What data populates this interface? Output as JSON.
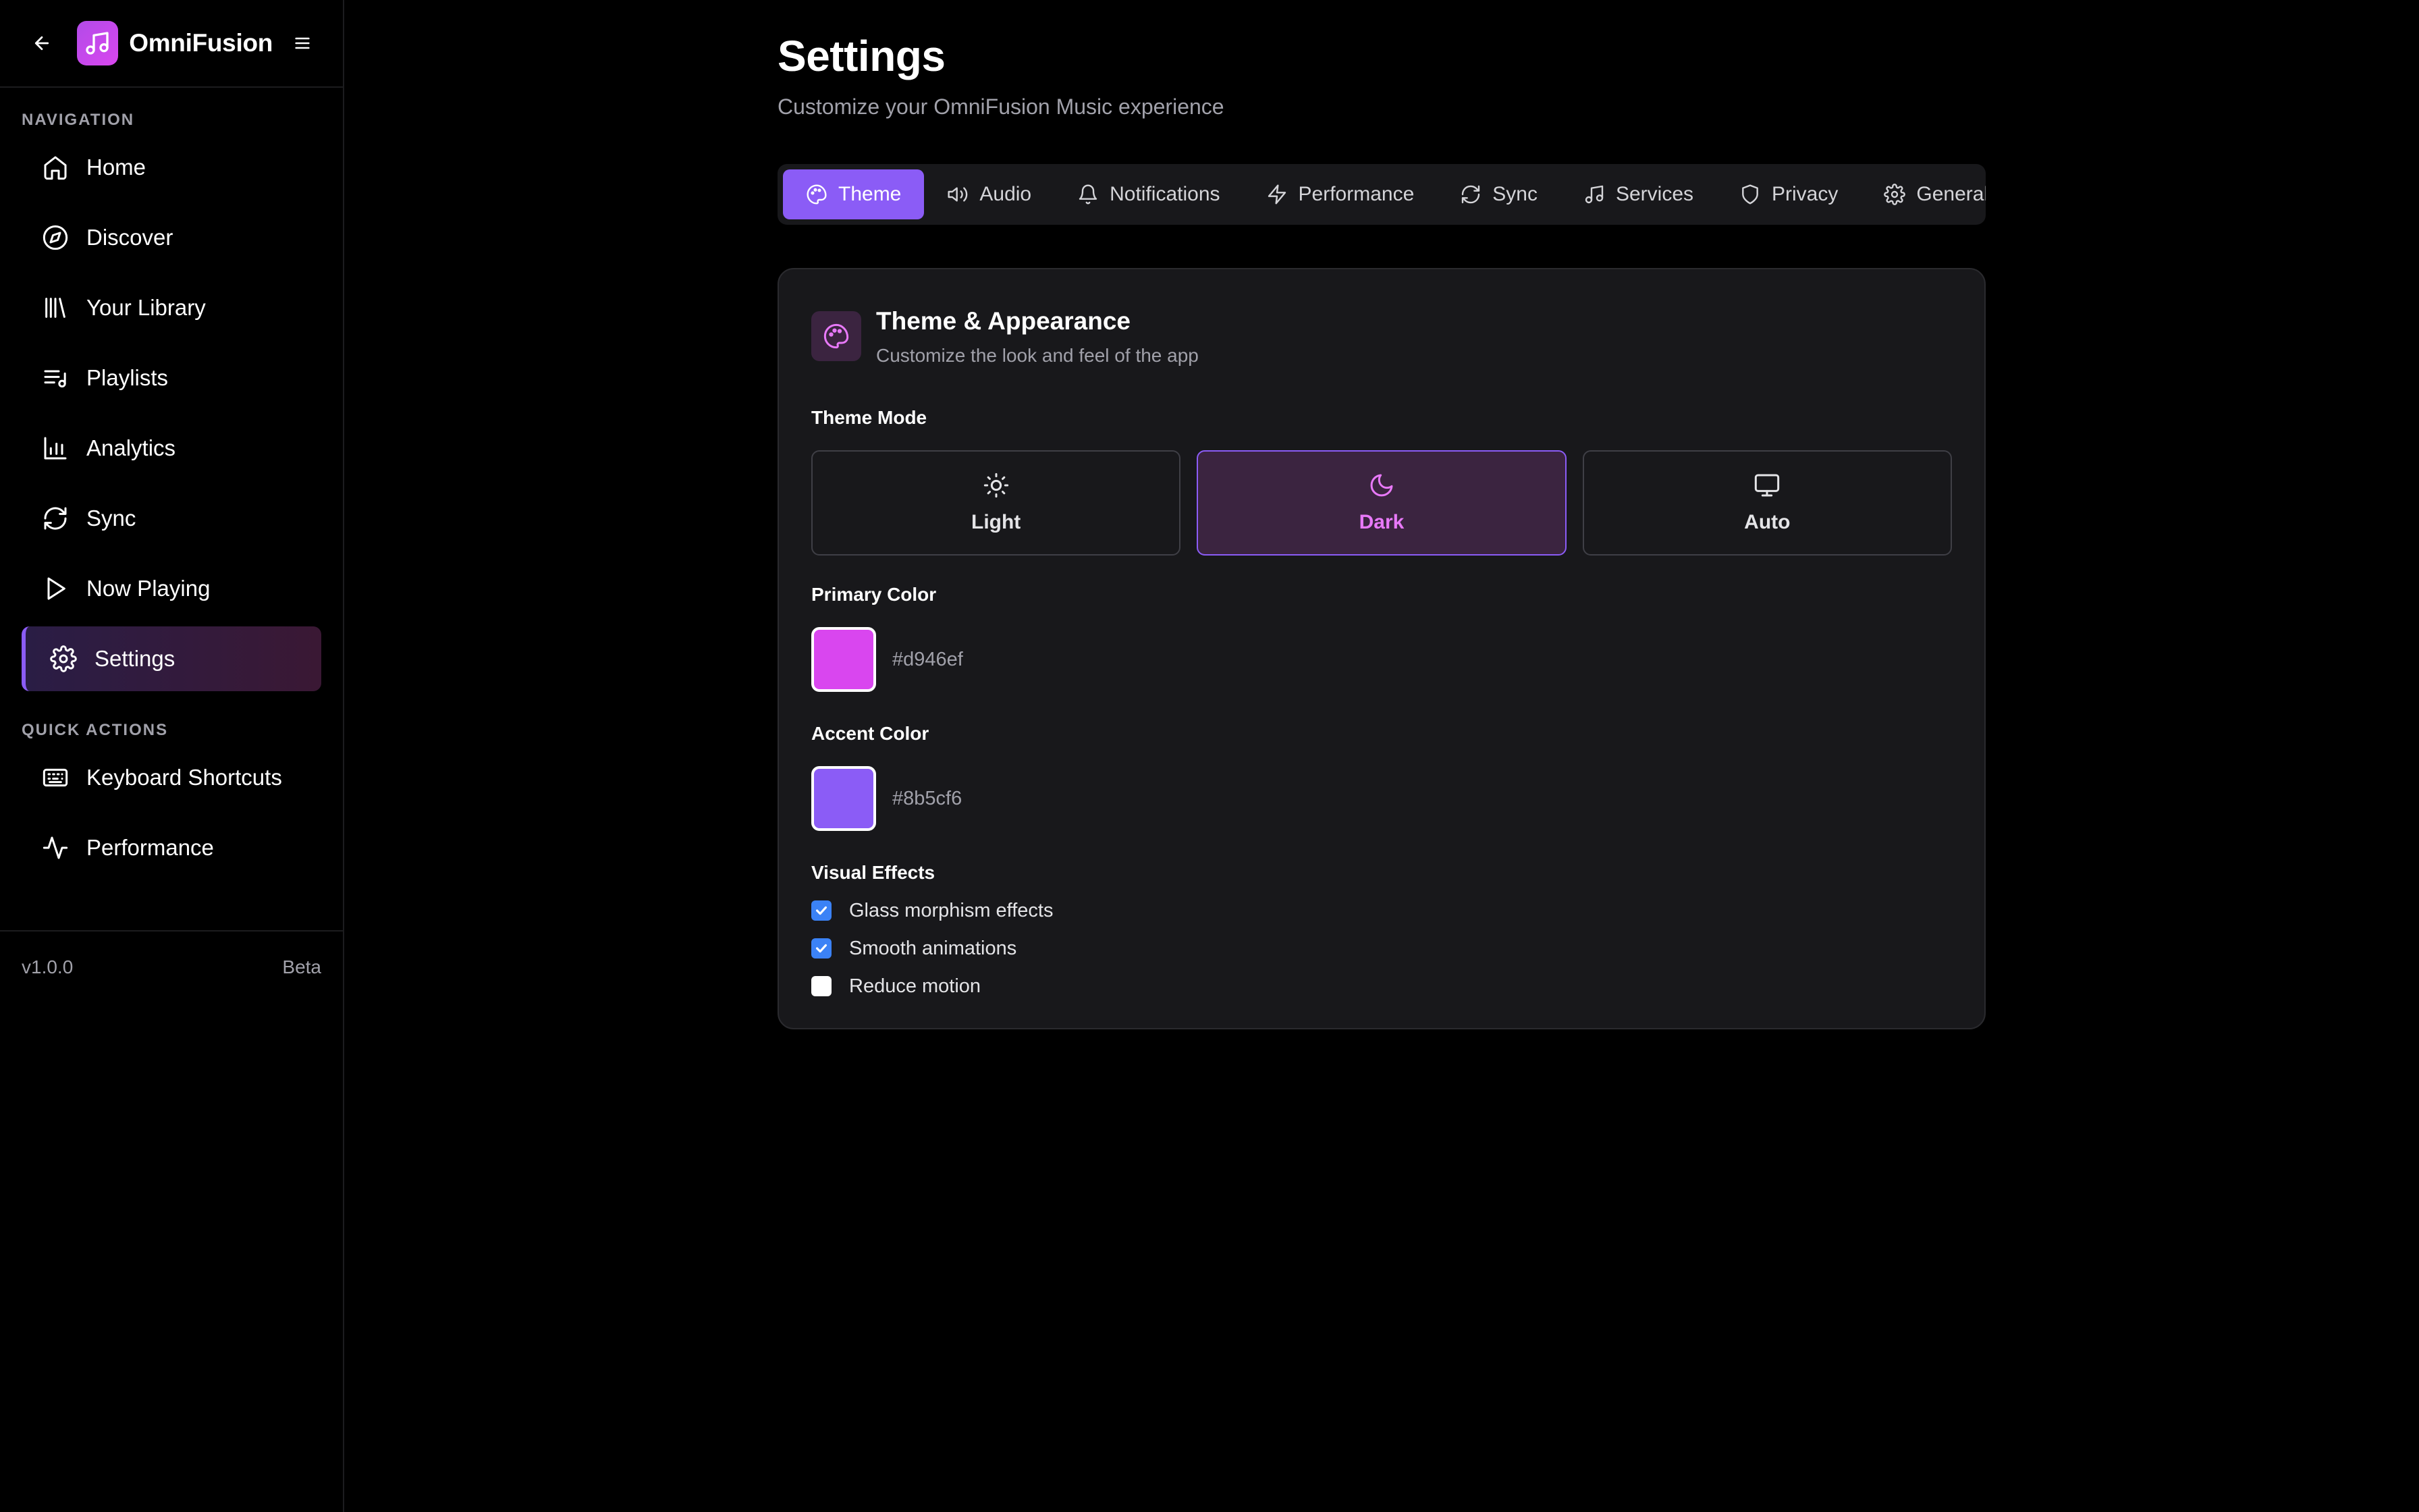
{
  "app": {
    "name": "OmniFusion"
  },
  "sidebar": {
    "nav_heading": "NAVIGATION",
    "items": [
      {
        "label": "Home",
        "icon": "home-icon"
      },
      {
        "label": "Discover",
        "icon": "compass-icon"
      },
      {
        "label": "Your Library",
        "icon": "library-icon"
      },
      {
        "label": "Playlists",
        "icon": "playlist-icon"
      },
      {
        "label": "Analytics",
        "icon": "bar-chart-icon"
      },
      {
        "label": "Sync",
        "icon": "sync-icon"
      },
      {
        "label": "Now Playing",
        "icon": "play-icon"
      },
      {
        "label": "Settings",
        "icon": "gear-icon",
        "active": true
      }
    ],
    "quick_heading": "QUICK ACTIONS",
    "quick_items": [
      {
        "label": "Keyboard Shortcuts",
        "icon": "keyboard-icon"
      },
      {
        "label": "Performance",
        "icon": "activity-icon"
      }
    ],
    "version": "v1.0.0",
    "channel": "Beta"
  },
  "page": {
    "title": "Settings",
    "subtitle": "Customize your OmniFusion Music experience"
  },
  "tabs": [
    {
      "label": "Theme",
      "icon": "palette-icon",
      "active": true
    },
    {
      "label": "Audio",
      "icon": "speaker-icon"
    },
    {
      "label": "Notifications",
      "icon": "bell-icon"
    },
    {
      "label": "Performance",
      "icon": "lightning-icon"
    },
    {
      "label": "Sync",
      "icon": "sync-icon"
    },
    {
      "label": "Services",
      "icon": "music-note-icon"
    },
    {
      "label": "Privacy",
      "icon": "shield-icon"
    },
    {
      "label": "General",
      "icon": "gear-icon"
    }
  ],
  "card": {
    "title": "Theme & Appearance",
    "description": "Customize the look and feel of the app",
    "theme_mode_label": "Theme Mode",
    "modes": [
      {
        "label": "Light",
        "icon": "sun-icon"
      },
      {
        "label": "Dark",
        "icon": "moon-icon",
        "selected": true
      },
      {
        "label": "Auto",
        "icon": "monitor-icon"
      }
    ],
    "primary_label": "Primary Color",
    "primary_value": "#d946ef",
    "accent_label": "Accent Color",
    "accent_value": "#8b5cf6",
    "effects_label": "Visual Effects",
    "effects": [
      {
        "label": "Glass morphism effects",
        "checked": true
      },
      {
        "label": "Smooth animations",
        "checked": true
      },
      {
        "label": "Reduce motion",
        "checked": false
      }
    ]
  }
}
